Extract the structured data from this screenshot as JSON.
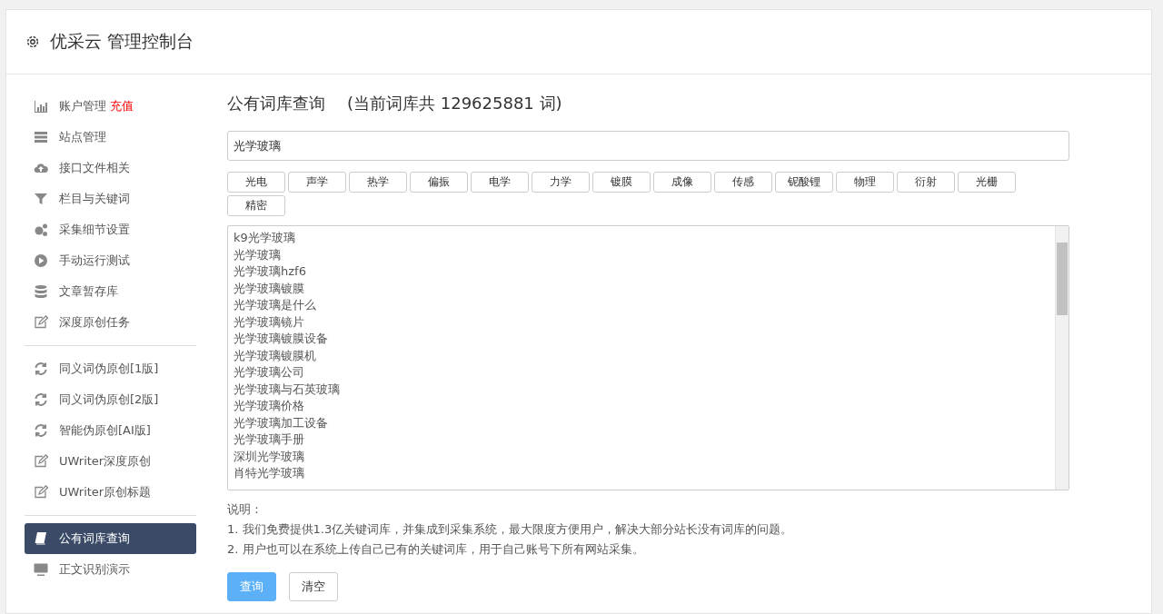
{
  "header": {
    "title": "优采云 管理控制台"
  },
  "sidebar": {
    "groups": [
      {
        "items": [
          {
            "label": "账户管理",
            "badge": "充值",
            "selected": false
          },
          {
            "label": "站点管理",
            "selected": false
          },
          {
            "label": "接口文件相关",
            "selected": false
          },
          {
            "label": "栏目与关键词",
            "selected": false
          },
          {
            "label": "采集细节设置",
            "selected": false
          },
          {
            "label": "手动运行测试",
            "selected": false
          },
          {
            "label": "文章暂存库",
            "selected": false
          },
          {
            "label": "深度原创任务",
            "selected": false
          }
        ]
      },
      {
        "items": [
          {
            "label": "同义词伪原创[1版]",
            "selected": false
          },
          {
            "label": "同义词伪原创[2版]",
            "selected": false
          },
          {
            "label": "智能伪原创[AI版]",
            "selected": false
          },
          {
            "label": "UWriter深度原创",
            "selected": false
          },
          {
            "label": "UWriter原创标题",
            "selected": false
          }
        ]
      },
      {
        "items": [
          {
            "label": "公有词库查询",
            "selected": true
          },
          {
            "label": "正文识别演示",
            "selected": false
          }
        ]
      }
    ]
  },
  "main": {
    "title": "公有词库查询",
    "count_note": "(当前词库共 129625881 词)",
    "search": {
      "value": "光学玻璃"
    },
    "tags": [
      "光电",
      "声学",
      "热学",
      "偏振",
      "电学",
      "力学",
      "镀膜",
      "成像",
      "传感",
      "铌酸锂",
      "物理",
      "衍射",
      "光栅",
      "精密"
    ],
    "results": [
      "k9光学玻璃",
      "光学玻璃",
      "光学玻璃hzf6",
      "光学玻璃镀膜",
      "光学玻璃是什么",
      "光学玻璃镜片",
      "光学玻璃镀膜设备",
      "光学玻璃镀膜机",
      "光学玻璃公司",
      "光学玻璃与石英玻璃",
      "光学玻璃价格",
      "光学玻璃加工设备",
      "光学玻璃手册",
      "深圳光学玻璃",
      "肖特光学玻璃"
    ],
    "notes": [
      "说明：",
      "1. 我们免费提供1.3亿关键词库，并集成到采集系统，最大限度方便用户，解决大部分站长没有词库的问题。",
      "2. 用户也可以在系统上传自己已有的关键词库，用于自己账号下所有网站采集。"
    ],
    "buttons": [
      {
        "label": "查询",
        "kind": "primary"
      },
      {
        "label": "清空",
        "kind": "default"
      }
    ]
  }
}
